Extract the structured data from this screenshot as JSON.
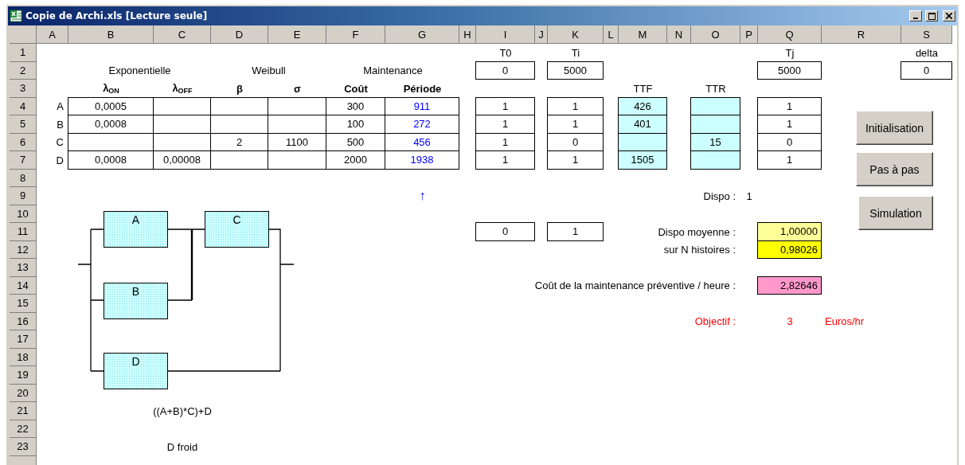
{
  "window": {
    "title": "Copie de Archi.xls  [Lecture seule]"
  },
  "columns": [
    "A",
    "B",
    "C",
    "D",
    "E",
    "F",
    "G",
    "H",
    "I",
    "J",
    "K",
    "L",
    "M",
    "N",
    "O",
    "P",
    "Q",
    "R",
    "S"
  ],
  "rows": [
    {
      "header": "1",
      "cells": [
        null,
        null,
        null,
        null,
        null,
        null,
        null,
        null,
        {
          "kind": "label",
          "text": "T0"
        },
        null,
        {
          "kind": "label",
          "text": "Ti"
        },
        null,
        null,
        null,
        null,
        null,
        {
          "kind": "label",
          "text": "Tj"
        },
        null,
        {
          "kind": "label",
          "text": "delta"
        }
      ]
    },
    {
      "header": "2",
      "cells": [
        null,
        {
          "kind": "label",
          "merged": true,
          "text": "Exponentielle"
        },
        null,
        {
          "kind": "label",
          "merged": true,
          "text": "Weibull"
        },
        null,
        {
          "kind": "label",
          "merged": true,
          "text": "Maintenance"
        },
        null,
        null,
        {
          "kind": "box",
          "text": "0"
        },
        null,
        {
          "kind": "box",
          "text": "5000"
        },
        null,
        null,
        null,
        null,
        null,
        {
          "kind": "box",
          "text": "5000"
        },
        null,
        {
          "kind": "box",
          "text": "0"
        }
      ]
    },
    {
      "header": "3",
      "cells": [
        null,
        {
          "kind": "bold",
          "text": "λ$_{ON}$"
        },
        {
          "kind": "bold",
          "text": "λ$_{OFF}$"
        },
        {
          "kind": "bold",
          "text": "β"
        },
        {
          "kind": "bold",
          "text": "σ"
        },
        {
          "kind": "bold",
          "text": "Coût"
        },
        {
          "kind": "bold",
          "text": "Période"
        },
        null,
        null,
        null,
        null,
        null,
        {
          "kind": "label",
          "text": "TTF"
        },
        null,
        {
          "kind": "label",
          "text": "TTR"
        }
      ]
    },
    {
      "header": "4",
      "cells": [
        {
          "kind": "label-right",
          "text": "A"
        },
        {
          "kind": "box",
          "text": "0,0005"
        },
        {
          "kind": "box"
        },
        {
          "kind": "box"
        },
        {
          "kind": "box"
        },
        {
          "kind": "box",
          "text": "300"
        },
        {
          "kind": "box-blue",
          "text": "911"
        },
        null,
        {
          "kind": "box",
          "text": "1"
        },
        null,
        {
          "kind": "box",
          "text": "1"
        },
        null,
        {
          "kind": "box-cyan",
          "text": "426"
        },
        null,
        {
          "kind": "box-cyan"
        },
        null,
        {
          "kind": "box",
          "text": "1"
        }
      ]
    },
    {
      "header": "5",
      "cells": [
        {
          "kind": "label-right",
          "text": "B"
        },
        {
          "kind": "box",
          "text": "0,0008"
        },
        {
          "kind": "box"
        },
        {
          "kind": "box"
        },
        {
          "kind": "box"
        },
        {
          "kind": "box",
          "text": "100"
        },
        {
          "kind": "box-blue",
          "text": "272"
        },
        null,
        {
          "kind": "box",
          "text": "1"
        },
        null,
        {
          "kind": "box",
          "text": "1"
        },
        null,
        {
          "kind": "box-cyan",
          "text": "401"
        },
        null,
        {
          "kind": "box-cyan"
        },
        null,
        {
          "kind": "box",
          "text": "1"
        }
      ]
    },
    {
      "header": "6",
      "cells": [
        {
          "kind": "label-right",
          "text": "C"
        },
        {
          "kind": "box"
        },
        {
          "kind": "box"
        },
        {
          "kind": "box",
          "text": "2"
        },
        {
          "kind": "box",
          "text": "1100"
        },
        {
          "kind": "box",
          "text": "500"
        },
        {
          "kind": "box-blue",
          "text": "456"
        },
        null,
        {
          "kind": "box",
          "text": "1"
        },
        null,
        {
          "kind": "box",
          "text": "0"
        },
        null,
        {
          "kind": "box-cyan"
        },
        null,
        {
          "kind": "box-cyan",
          "text": "15"
        },
        null,
        {
          "kind": "box",
          "text": "0"
        }
      ]
    },
    {
      "header": "7",
      "cells": [
        {
          "kind": "label-right",
          "text": "D"
        },
        {
          "kind": "box",
          "text": "0,0008"
        },
        {
          "kind": "box",
          "text": "0,00008"
        },
        {
          "kind": "box"
        },
        {
          "kind": "box"
        },
        {
          "kind": "box",
          "text": "2000"
        },
        {
          "kind": "box-blue",
          "text": "1938"
        },
        null,
        {
          "kind": "box",
          "text": "1"
        },
        null,
        {
          "kind": "box",
          "text": "1"
        },
        null,
        {
          "kind": "box-cyan",
          "text": "1505"
        },
        null,
        {
          "kind": "box-cyan"
        },
        null,
        {
          "kind": "box",
          "text": "1"
        }
      ]
    },
    {
      "header": "8"
    },
    {
      "header": "9",
      "cells": [
        null,
        null,
        null,
        null,
        null,
        null,
        {
          "kind": "arrow",
          "text": "↑"
        },
        null,
        null,
        null,
        null,
        null,
        null,
        null,
        {
          "kind": "label-right",
          "text": "Dispo :"
        },
        {
          "kind": "label",
          "text": "1"
        }
      ]
    },
    {
      "header": "10"
    },
    {
      "header": "11",
      "cells": [
        null,
        null,
        null,
        null,
        null,
        null,
        null,
        null,
        {
          "kind": "box",
          "text": "0"
        },
        null,
        {
          "kind": "box",
          "text": "1"
        },
        null,
        null,
        null,
        {
          "kind": "label-right",
          "text": "Dispo moyenne :"
        },
        null,
        {
          "kind": "box-lightyellow",
          "text": "1,00000"
        }
      ]
    },
    {
      "header": "12",
      "cells": [
        null,
        null,
        null,
        null,
        null,
        null,
        null,
        null,
        null,
        null,
        null,
        null,
        null,
        null,
        {
          "kind": "label-right",
          "text": "sur N histoires :"
        },
        null,
        {
          "kind": "box-yellow",
          "text": "0,98026"
        }
      ]
    },
    {
      "header": "13"
    },
    {
      "header": "14",
      "cells": [
        null,
        null,
        null,
        null,
        null,
        null,
        null,
        null,
        null,
        null,
        null,
        null,
        null,
        null,
        {
          "kind": "label-right",
          "text": "Coût de la maintenance préventive / heure :"
        },
        null,
        {
          "kind": "box-pink",
          "text": "2,82646"
        }
      ]
    },
    {
      "header": "15"
    },
    {
      "header": "16",
      "cells": [
        null,
        null,
        null,
        null,
        null,
        null,
        null,
        null,
        null,
        null,
        null,
        null,
        null,
        null,
        {
          "kind": "red-right",
          "text": "Objectif :"
        },
        null,
        {
          "kind": "red",
          "text": "3"
        },
        {
          "kind": "red-left",
          "text": "Euros/hr"
        }
      ]
    },
    {
      "header": "17"
    },
    {
      "header": "18"
    },
    {
      "header": "19"
    },
    {
      "header": "20"
    },
    {
      "header": "21",
      "cells": [
        null,
        null,
        {
          "kind": "label",
          "text": "((A+B)*C)+D"
        }
      ]
    },
    {
      "header": "22"
    },
    {
      "header": "23",
      "cells": [
        null,
        null,
        {
          "kind": "label",
          "text": "D froid"
        }
      ]
    }
  ],
  "diagram": {
    "blocks": [
      {
        "label": "A"
      },
      {
        "label": "B"
      },
      {
        "label": "C"
      },
      {
        "label": "D"
      }
    ]
  },
  "buttons": [
    {
      "label": "Initialisation"
    },
    {
      "label": "Pas à pas"
    },
    {
      "label": "Simulation"
    }
  ]
}
